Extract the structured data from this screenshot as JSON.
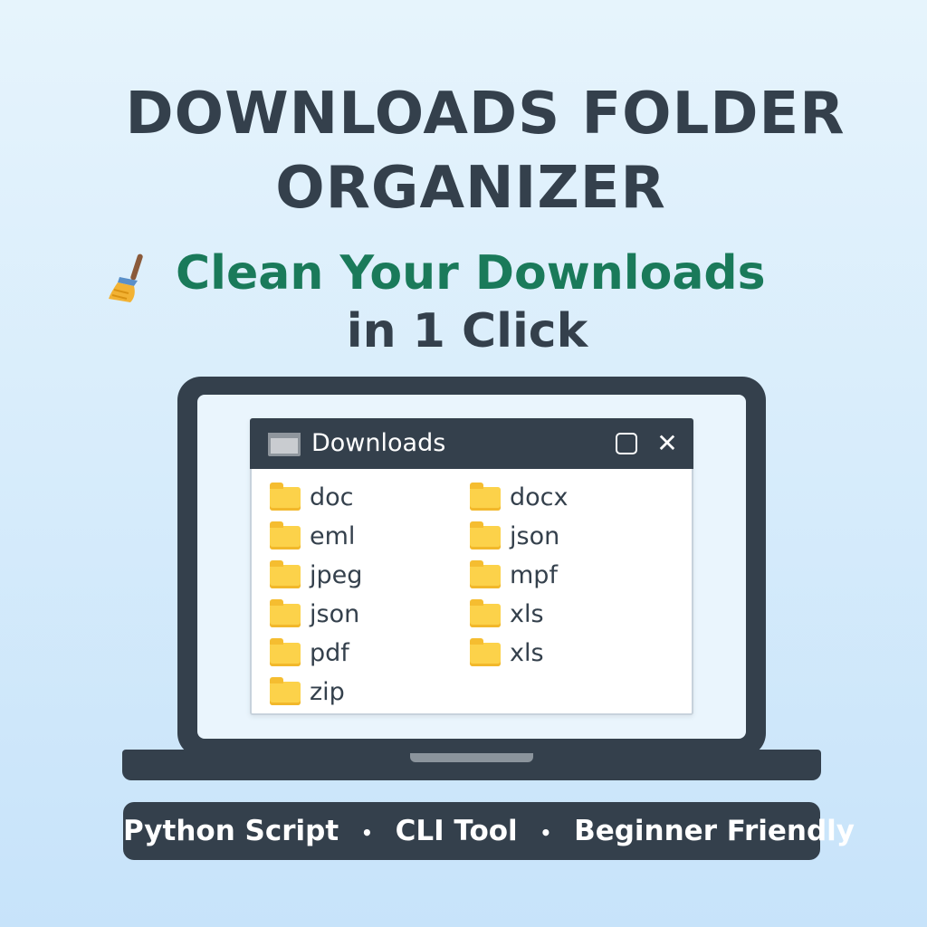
{
  "header": {
    "title_line1": "DOWNLOADS FOLDER",
    "title_line2": "ORGANIZER",
    "tagline": "Clean Your Downloads",
    "subline": "in 1 Click",
    "tagline_icon": "broom-icon"
  },
  "window": {
    "title": "Downloads",
    "close_glyph": "✕",
    "left_items": [
      {
        "label": "doc"
      },
      {
        "label": "eml"
      },
      {
        "label": "jpeg"
      },
      {
        "label": "json"
      },
      {
        "label": "pdf"
      },
      {
        "label": "zip"
      }
    ],
    "right_items": [
      {
        "label": "docx"
      },
      {
        "label": "json"
      },
      {
        "label": "mpf"
      },
      {
        "label": "xls"
      },
      {
        "label": "xls"
      }
    ]
  },
  "footer": {
    "item1": "Python Script",
    "item2": "CLI Tool",
    "item3": "Beginner Friendly",
    "separator": "•"
  },
  "colors": {
    "dark": "#34404c",
    "accent_green": "#1a7a5a",
    "folder_yellow": "#fcd24a",
    "background": "#d7ecfb"
  }
}
